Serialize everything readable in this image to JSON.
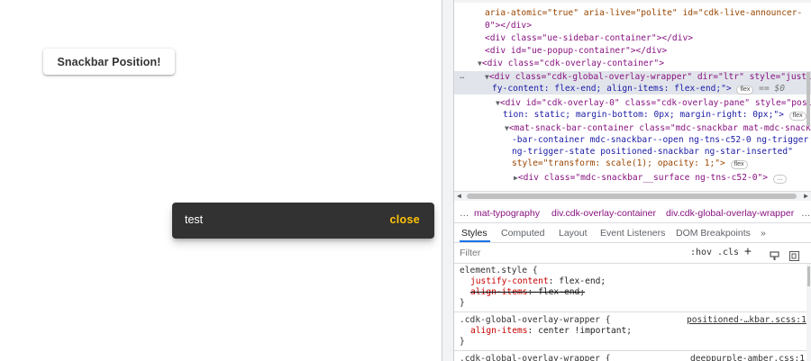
{
  "app": {
    "button_label": "Snackbar Position!",
    "snackbar": {
      "message": "test",
      "action": "close"
    }
  },
  "devtools": {
    "dom_lines": [
      "aria-atomic=\"true\" aria-live=\"polite\" id=\"cdk-live-announcer-",
      "0\"></div>",
      "<div class=\"ue-sidebar-container\"></div>",
      "<div id=\"ue-popup-container\"></div>",
      "<div class=\"cdk-overlay-container\">",
      "<div class=\"cdk-global-overlay-wrapper\" dir=\"ltr\" style=\"justi",
      "fy-content: flex-end; align-items: flex-end;\">",
      "<div id=\"cdk-overlay-0\" class=\"cdk-overlay-pane\" style=\"posi",
      "tion: static; margin-bottom: 0px; margin-right: 0px;\">",
      "<mat-snack-bar-container class=\"mdc-snackbar mat-mdc-snack",
      "-bar-container mdc-snackbar--open ng-tns-c52-0 ng-trigger",
      "ng-trigger-state positioned-snackbar ng-star-inserted\"",
      "style=\"transform: scale(1); opacity: 1;\">",
      "<div class=\"mdc-snackbar__surface ng-tns-c52-0\">"
    ],
    "badge_flex": "flex",
    "selected_marker": "== $0",
    "gutter_dots": "…",
    "breadcrumbs": [
      "…",
      "mat-typography",
      "div.cdk-overlay-container",
      "div.cdk-global-overlay-wrapper",
      "…"
    ],
    "tabs": [
      "Styles",
      "Computed",
      "Layout",
      "Event Listeners",
      "DOM Breakpoints",
      "»"
    ],
    "filter": {
      "placeholder": "Filter",
      "hov": ":hov",
      "cls": ".cls",
      "plus": "+"
    },
    "styles": {
      "rule1": {
        "selector": "element.style {",
        "prop1": "justify-content",
        "val1": "flex-end;",
        "prop2": "align-items",
        "val2": "flex-end;",
        "close": "}"
      },
      "rule2": {
        "selector": ".cdk-global-overlay-wrapper {",
        "source": "positioned-…kbar.scss:1",
        "prop1": "align-items",
        "val1": "center !important;",
        "close": "}"
      },
      "rule3": {
        "selector": ".cdk-global-overlay-wrapper {",
        "source": "deeppurple-amber.css:1"
      }
    }
  }
}
